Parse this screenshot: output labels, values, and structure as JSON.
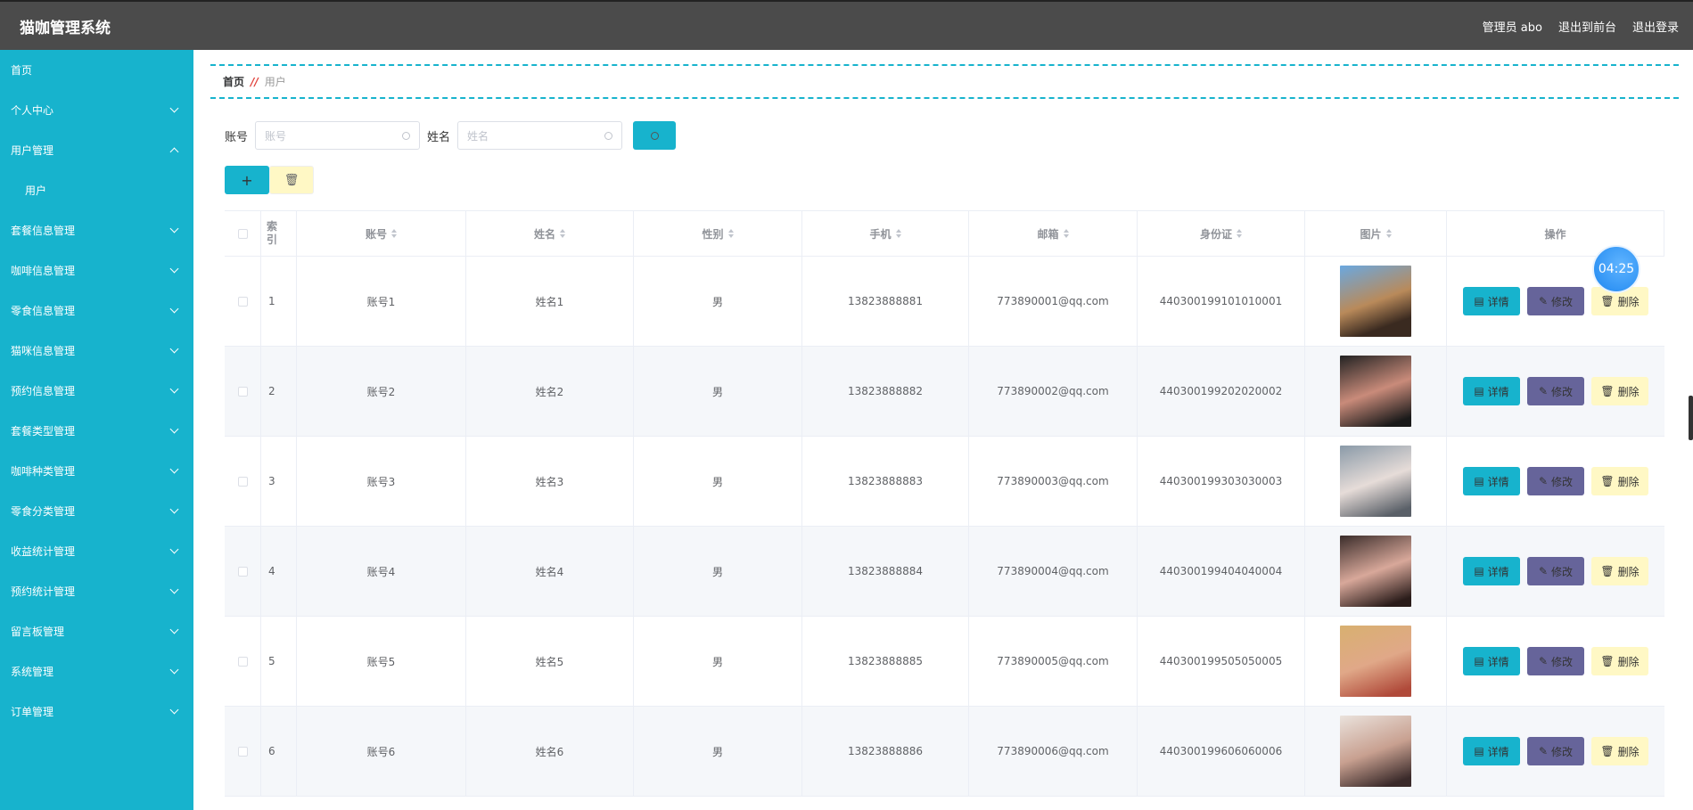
{
  "header": {
    "title": "猫咖管理系统",
    "user": "管理员 abo",
    "to_front": "退出到前台",
    "logout": "退出登录"
  },
  "sidebar": {
    "items": [
      {
        "label": "首页",
        "chev": ""
      },
      {
        "label": "个人中心",
        "chev": "down"
      },
      {
        "label": "用户管理",
        "chev": "up"
      },
      {
        "label": "用户",
        "chev": "",
        "sub": true
      },
      {
        "label": "套餐信息管理",
        "chev": "down"
      },
      {
        "label": "咖啡信息管理",
        "chev": "down"
      },
      {
        "label": "零食信息管理",
        "chev": "down"
      },
      {
        "label": "猫咪信息管理",
        "chev": "down"
      },
      {
        "label": "预约信息管理",
        "chev": "down"
      },
      {
        "label": "套餐类型管理",
        "chev": "down"
      },
      {
        "label": "咖啡种类管理",
        "chev": "down"
      },
      {
        "label": "零食分类管理",
        "chev": "down"
      },
      {
        "label": "收益统计管理",
        "chev": "down"
      },
      {
        "label": "预约统计管理",
        "chev": "down"
      },
      {
        "label": "留言板管理",
        "chev": "down"
      },
      {
        "label": "系统管理",
        "chev": "down"
      },
      {
        "label": "订单管理",
        "chev": "down"
      }
    ]
  },
  "breadcrumb": {
    "home": "首页",
    "sep": "//",
    "current": "用户"
  },
  "search": {
    "account_label": "账号",
    "account_placeholder": "账号",
    "name_label": "姓名",
    "name_placeholder": "姓名"
  },
  "table": {
    "headers": [
      "索引",
      "账号",
      "姓名",
      "性别",
      "手机",
      "邮箱",
      "身份证",
      "图片",
      "操作"
    ],
    "rows": [
      {
        "index": "1",
        "account": "账号1",
        "name": "姓名1",
        "gender": "男",
        "phone": "13823888881",
        "email": "773890001@qq.com",
        "id": "440300199101010001"
      },
      {
        "index": "2",
        "account": "账号2",
        "name": "姓名2",
        "gender": "男",
        "phone": "13823888882",
        "email": "773890002@qq.com",
        "id": "440300199202020002"
      },
      {
        "index": "3",
        "account": "账号3",
        "name": "姓名3",
        "gender": "男",
        "phone": "13823888883",
        "email": "773890003@qq.com",
        "id": "440300199303030003"
      },
      {
        "index": "4",
        "account": "账号4",
        "name": "姓名4",
        "gender": "男",
        "phone": "13823888884",
        "email": "773890004@qq.com",
        "id": "440300199404040004"
      },
      {
        "index": "5",
        "account": "账号5",
        "name": "姓名5",
        "gender": "男",
        "phone": "13823888885",
        "email": "773890005@qq.com",
        "id": "440300199505050005"
      },
      {
        "index": "6",
        "account": "账号6",
        "name": "姓名6",
        "gender": "男",
        "phone": "13823888886",
        "email": "773890006@qq.com",
        "id": "440300199606060006"
      }
    ],
    "actions": {
      "detail": "详情",
      "edit": "修改",
      "delete": "删除"
    }
  },
  "timer": "04:25",
  "colors": {
    "accent": "#17b3cd",
    "header": "#4b4b4b",
    "edit": "#66649a",
    "delete": "#fff8c5"
  }
}
